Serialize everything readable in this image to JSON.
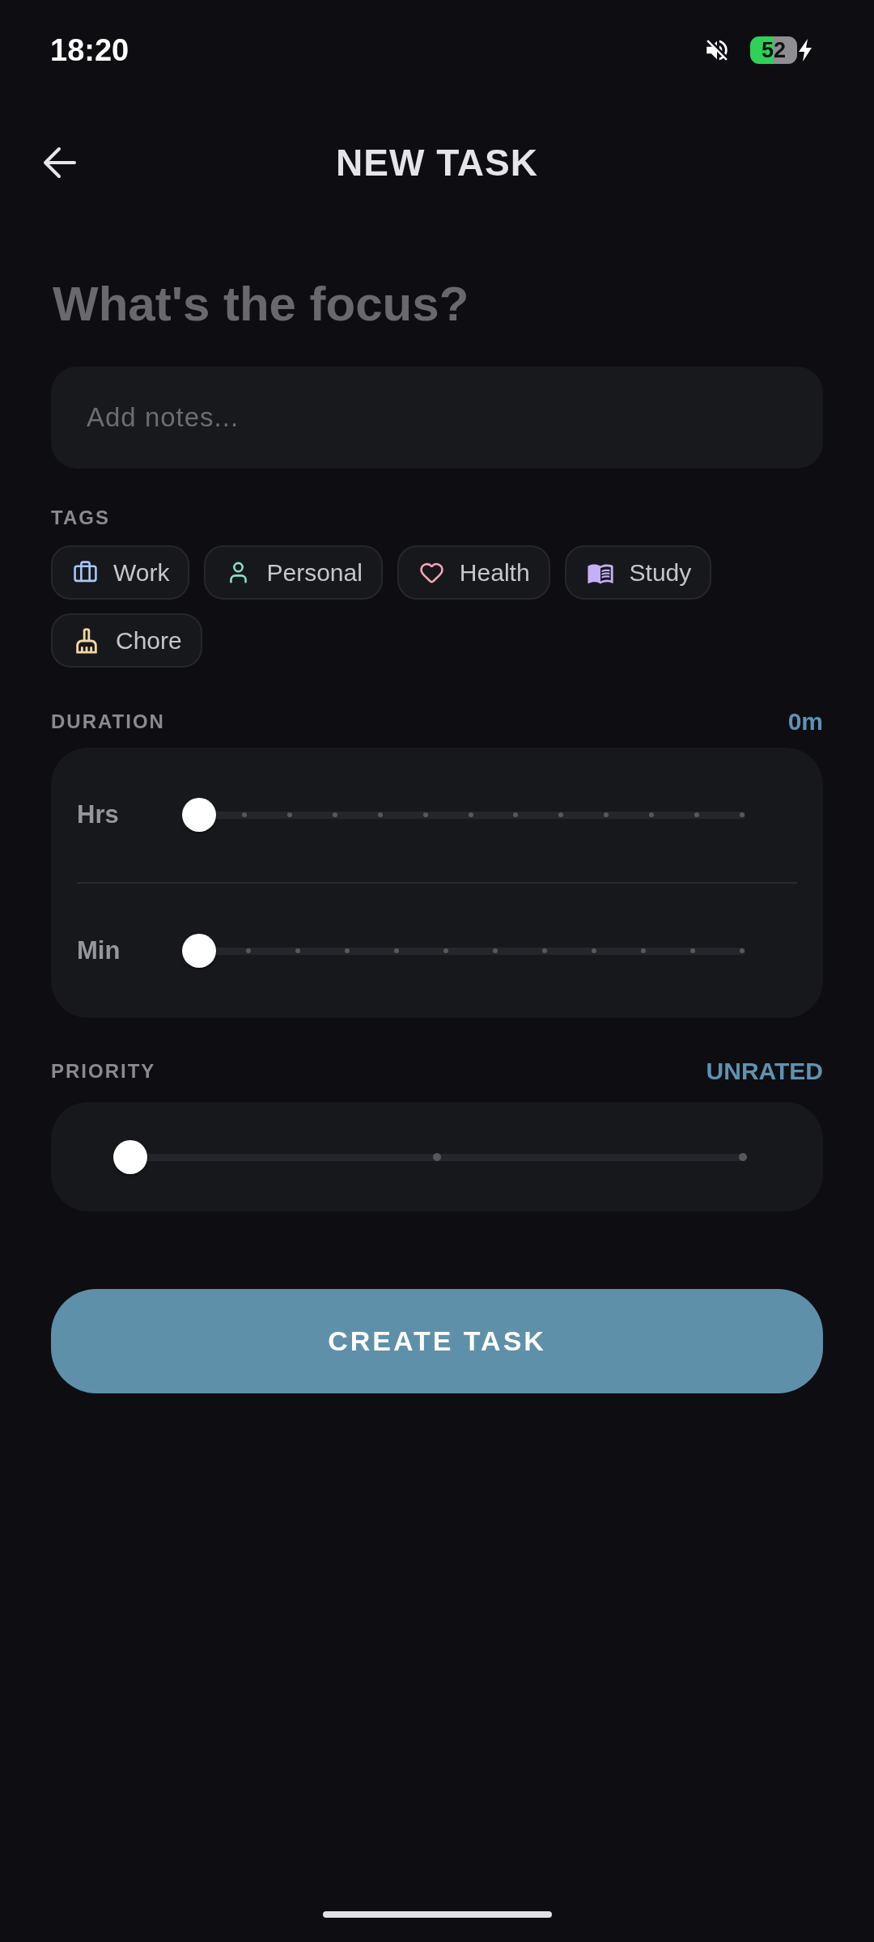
{
  "status_bar": {
    "time": "18:20",
    "battery": "52"
  },
  "header": {
    "title": "NEW TASK"
  },
  "title_field": {
    "placeholder": "What's the focus?"
  },
  "notes_field": {
    "placeholder": "Add notes..."
  },
  "tags": {
    "label": "TAGS",
    "items": [
      {
        "kind": "work",
        "label": "Work",
        "color": "#a8c8f4",
        "selected": false
      },
      {
        "kind": "personal",
        "label": "Personal",
        "color": "#88e0c8",
        "selected": false
      },
      {
        "kind": "health",
        "label": "Health",
        "color": "#f4a6b4",
        "selected": false
      },
      {
        "kind": "study",
        "label": "Study",
        "color": "#c4b0f8",
        "selected": false
      },
      {
        "kind": "chore",
        "label": "Chore",
        "color": "#f4d8a0",
        "selected": false
      }
    ]
  },
  "duration": {
    "label": "DURATION",
    "value": "0m",
    "sliders": [
      {
        "kind": "hours",
        "label": "Hrs",
        "level": 0
      },
      {
        "kind": "minutes",
        "label": "Min",
        "level": 0
      }
    ]
  },
  "priority": {
    "label": "PRIORITY",
    "value": "UNRATED",
    "slider": {
      "kind": "priority",
      "level": 0
    }
  },
  "create_button": {
    "label": "CREATE TASK"
  }
}
